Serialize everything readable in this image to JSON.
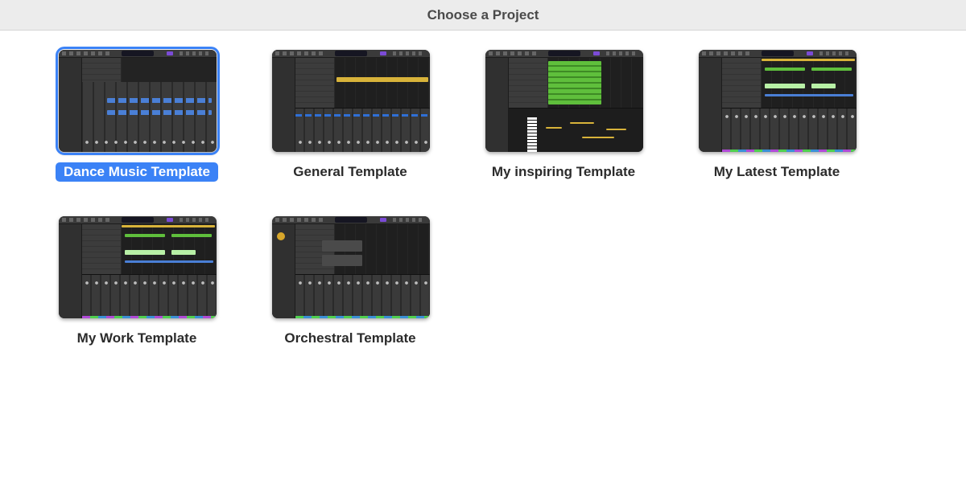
{
  "window": {
    "title": "Choose a Project"
  },
  "templates": [
    {
      "label": "Dance Music Template",
      "selected": true,
      "thumbnail": "daw-mixer-screenshot"
    },
    {
      "label": "General Template",
      "selected": false,
      "thumbnail": "daw-arrange-yellow-screenshot"
    },
    {
      "label": "My inspiring Template",
      "selected": false,
      "thumbnail": "daw-piano-roll-screenshot"
    },
    {
      "label": "My Latest Template",
      "selected": false,
      "thumbnail": "daw-green-regions-screenshot"
    },
    {
      "label": "My Work Template",
      "selected": false,
      "thumbnail": "daw-green-regions-screenshot"
    },
    {
      "label": "Orchestral Template",
      "selected": false,
      "thumbnail": "daw-orchestral-screenshot"
    }
  ],
  "colors": {
    "selection": "#3b82f6",
    "title_bar": "#ececec",
    "thumbnail_bg": "#2a2a2a"
  }
}
